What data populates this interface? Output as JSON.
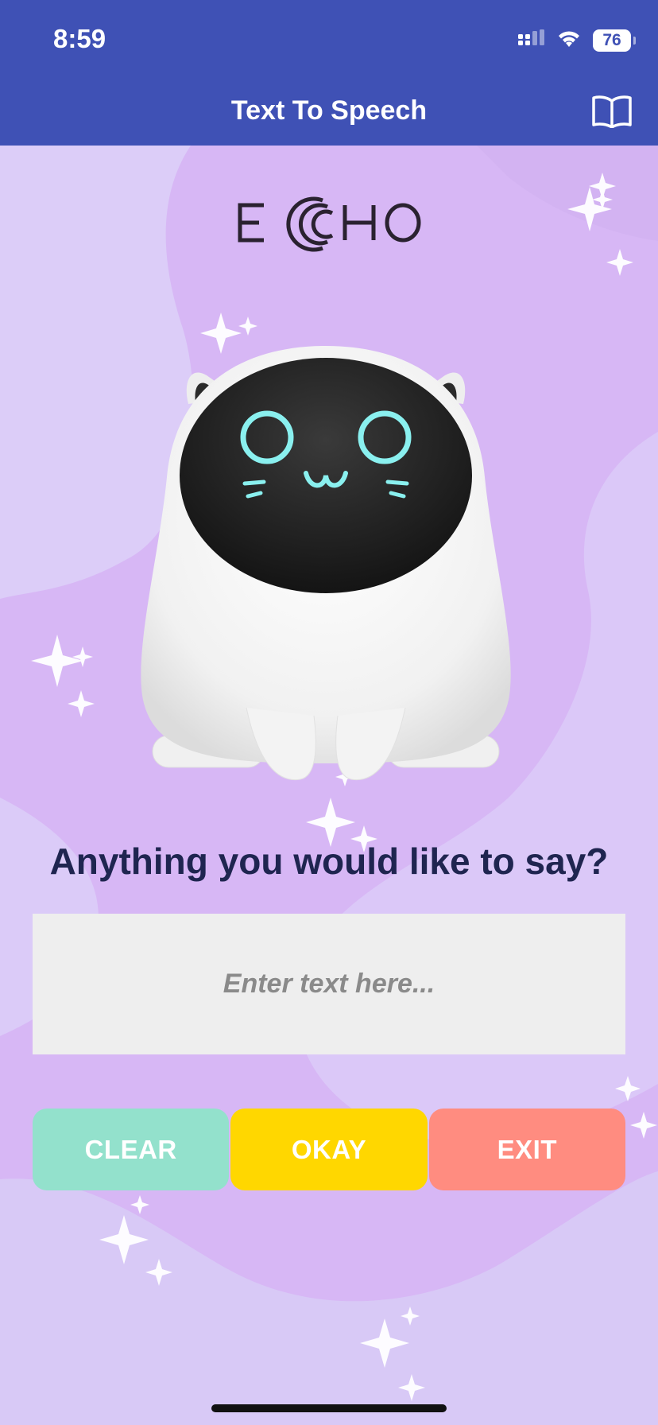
{
  "status_bar": {
    "time": "8:59",
    "battery": "76",
    "icons": [
      "cellular-signal-icon",
      "wifi-icon",
      "battery-icon"
    ]
  },
  "nav": {
    "title": "Text To Speech",
    "book_icon": "book-icon"
  },
  "logo": {
    "text": "ECHO"
  },
  "main": {
    "prompt": "Anything you would like to say?",
    "input": {
      "value": "",
      "placeholder": "Enter text here..."
    }
  },
  "buttons": [
    {
      "label": "CLEAR",
      "color": "#93e1cc"
    },
    {
      "label": "OKAY",
      "color": "#ffd700"
    },
    {
      "label": "EXIT",
      "color": "#ff8c80"
    }
  ],
  "colors": {
    "header": "#3f51b5",
    "background": "#d8b8f4",
    "prompt_text": "#1f2550",
    "input_bg": "#eeeeee"
  }
}
